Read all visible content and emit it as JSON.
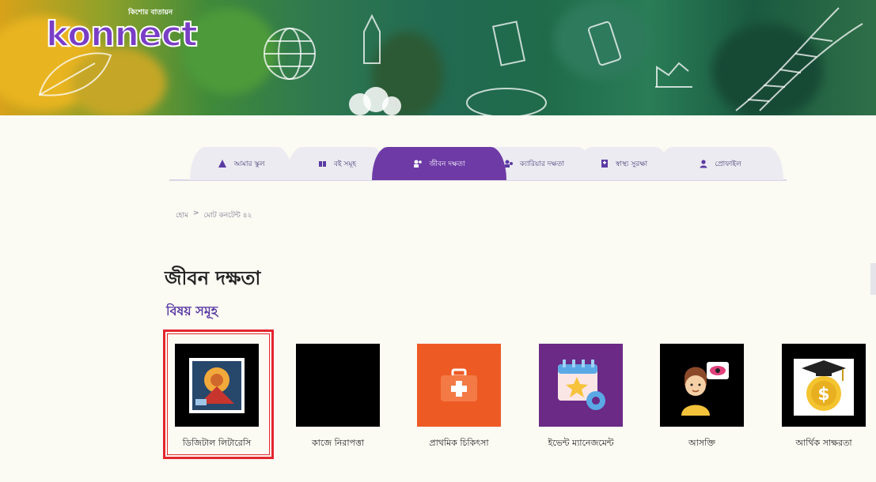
{
  "brand": {
    "tagline": "কিশোর বাতায়ন",
    "name": "konnect"
  },
  "nav": {
    "tabs": [
      {
        "label": "আমার স্কুল",
        "icon": "school-icon",
        "active": false
      },
      {
        "label": "বই সমূহ",
        "icon": "books-icon",
        "active": false
      },
      {
        "label": "জীবন দক্ষতা",
        "icon": "life-skills-icon",
        "active": true
      },
      {
        "label": "ক্যারিয়ার দক্ষতা",
        "icon": "career-icon",
        "active": false
      },
      {
        "label": "স্বাস্থ্য সুরক্ষা",
        "icon": "health-icon",
        "active": false
      },
      {
        "label": "প্রোফাইল",
        "icon": "profile-icon",
        "active": false
      }
    ]
  },
  "breadcrumb": {
    "home": "হোম",
    "separator": ">",
    "current": "মোট কনটেন্ট ৪২"
  },
  "page": {
    "title": "জীবন দক্ষতা",
    "section": "বিষয় সমূহ"
  },
  "topics": [
    {
      "label": "ডিজিটাল লিটারেসি",
      "icon": "digital-literacy-icon",
      "bg": "#000000",
      "selected": true
    },
    {
      "label": "কাজে নিরাপত্তা",
      "icon": "blank-thumbnail",
      "bg": "#000000",
      "selected": false
    },
    {
      "label": "প্রাথমিক চিকিৎসা",
      "icon": "first-aid-icon",
      "bg": "#ee5a24",
      "selected": false
    },
    {
      "label": "ইভেন্ট ম্যানেজমেন্ট",
      "icon": "event-management-icon",
      "bg": "#6a2a86",
      "selected": false
    },
    {
      "label": "আসক্তি",
      "icon": "addiction-icon",
      "bg": "#000000",
      "selected": false
    },
    {
      "label": "আর্থিক সাক্ষরতা",
      "icon": "financial-literacy-icon",
      "bg": "#000000",
      "selected": false
    }
  ],
  "colors": {
    "accent": "#6e3aa6",
    "selection": "#e3262f"
  }
}
